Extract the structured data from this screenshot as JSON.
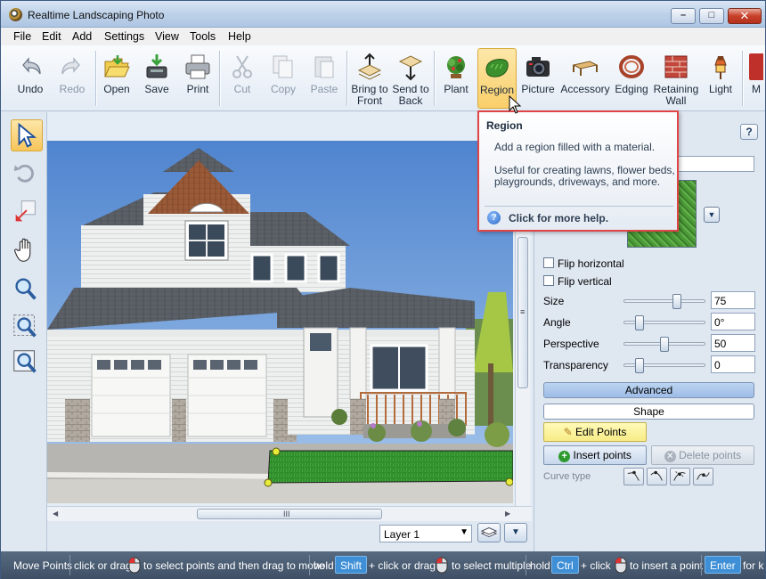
{
  "window": {
    "title": "Realtime Landscaping Photo"
  },
  "menu": [
    "File",
    "Edit",
    "Add",
    "Settings",
    "View",
    "Tools",
    "Help"
  ],
  "toolbar": {
    "undo": "Undo",
    "redo": "Redo",
    "open": "Open",
    "save": "Save",
    "print": "Print",
    "cut": "Cut",
    "copy": "Copy",
    "paste": "Paste",
    "bring_front_1": "Bring to",
    "bring_front_2": "Front",
    "send_back_1": "Send to",
    "send_back_2": "Back",
    "plant": "Plant",
    "region": "Region",
    "picture": "Picture",
    "accessory": "Accessory",
    "edging": "Edging",
    "retaining_1": "Retaining",
    "retaining_2": "Wall",
    "light": "Light",
    "more": "M"
  },
  "tooltip": {
    "title": "Region",
    "description": "Add a region filled with a material.",
    "extra": "Useful for creating lawns, flower beds, playgrounds, driveways, and more.",
    "help": "Click for more help."
  },
  "panel": {
    "help_label": "?",
    "flip_horizontal": "Flip horizontal",
    "flip_vertical": "Flip vertical",
    "size_label": "Size",
    "size_value": "75",
    "size_level": 0.67,
    "angle_label": "Angle",
    "angle_value": "0°",
    "angle_level": 0.15,
    "perspective_label": "Perspective",
    "perspective_value": "50",
    "perspective_level": 0.5,
    "transparency_label": "Transparency",
    "transparency_value": "0",
    "transparency_level": 0.15,
    "advanced": "Advanced",
    "shape": "Shape",
    "edit_points": "Edit Points",
    "insert_points": "Insert points",
    "delete_points": "Delete points",
    "curve_type": "Curve type"
  },
  "layer": {
    "selected": "Layer 1"
  },
  "scroll": {
    "h_grip": "III",
    "v_grip": "≡"
  },
  "status": {
    "mode": "Move Points",
    "s1": "click or drag",
    "s2": "to select points and then drag to move",
    "s3": "hold",
    "k1": "Shift",
    "s4": "+ click or drag",
    "s5": "to select multiple",
    "s6": "hold",
    "k2": "Ctrl",
    "s7": "+ click",
    "s8": "to insert a point",
    "k3": "Enter",
    "s9": "for k"
  },
  "colors": {
    "accent": "#3e8fd6",
    "tooltip_border": "#e04545",
    "active_tool": "#f9cf6a"
  }
}
